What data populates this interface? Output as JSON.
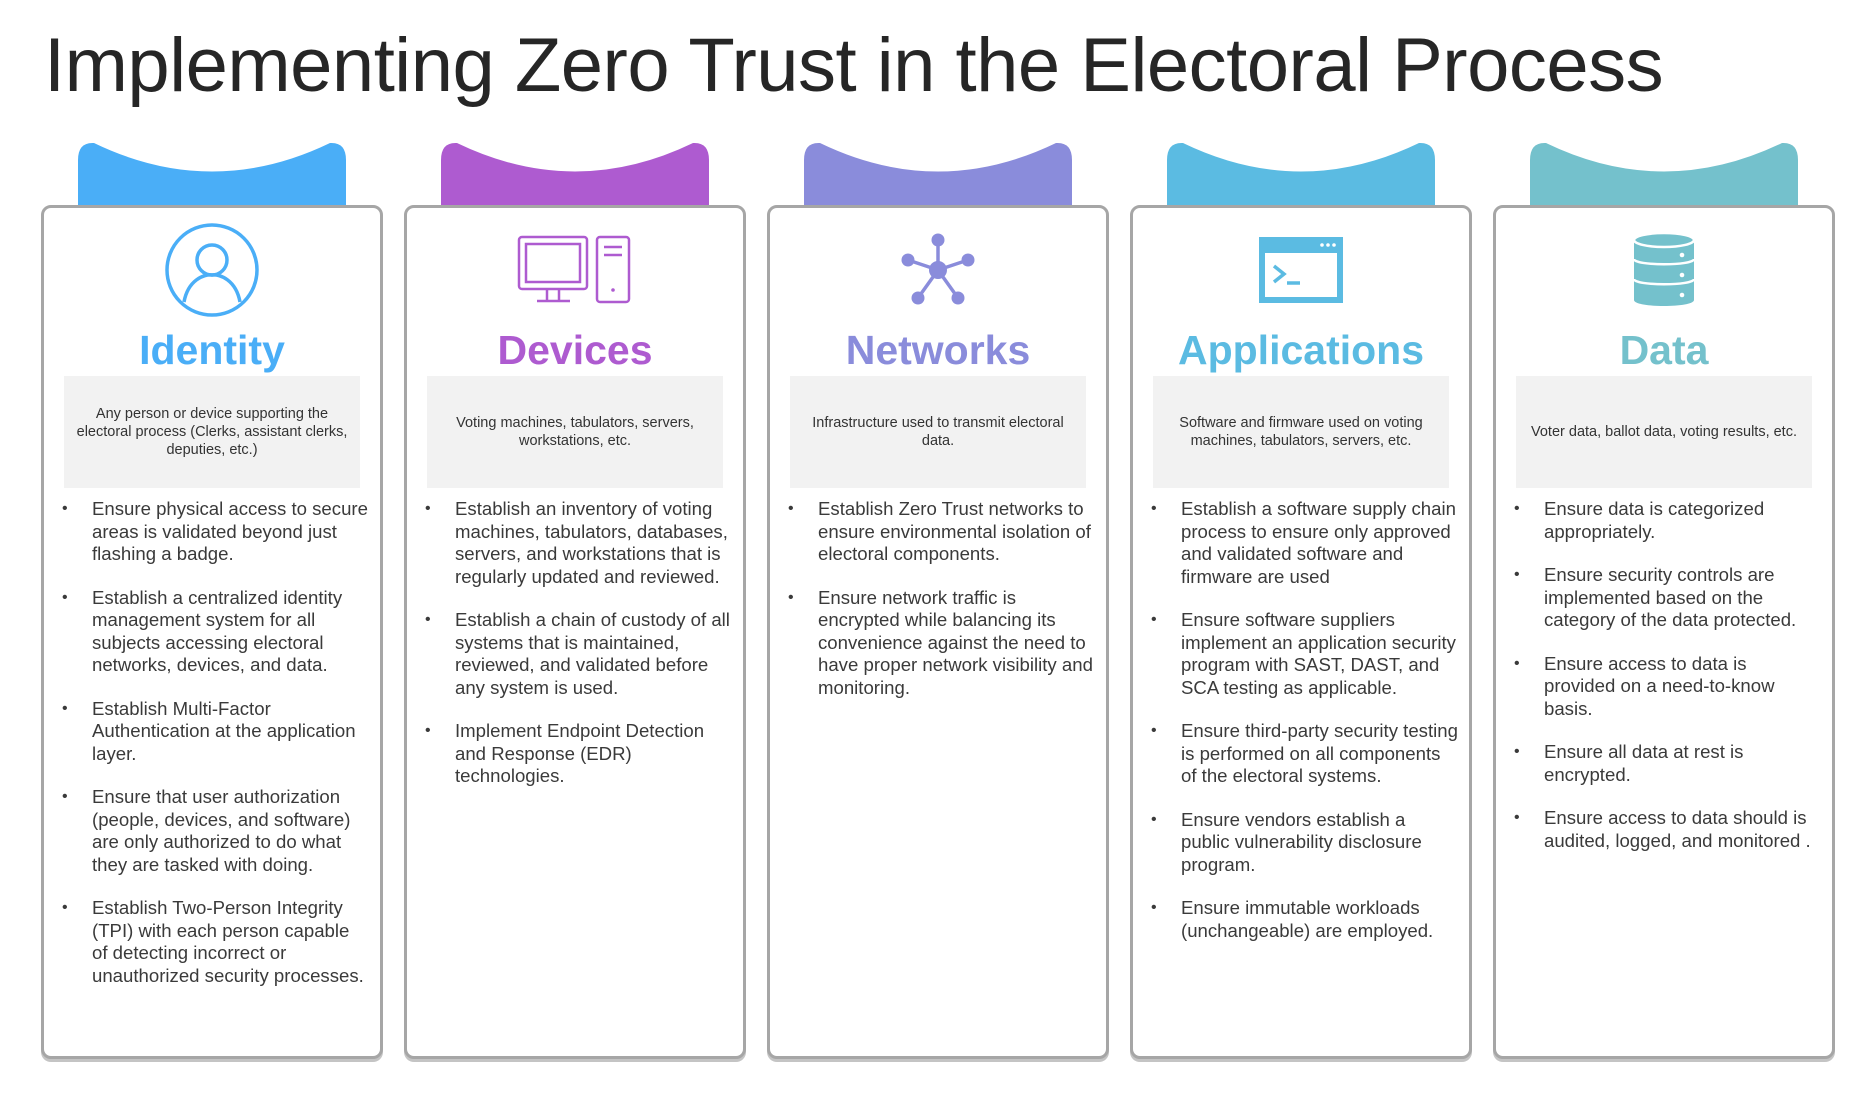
{
  "title": "Implementing Zero Trust in the Electoral Process",
  "columns": [
    {
      "id": "identity",
      "heading": "Identity",
      "color": "#4aaef7",
      "icon": "user-circle-icon",
      "description": "Any person or device supporting the electoral process (Clerks, assistant clerks, deputies, etc.)",
      "bullets": [
        "Ensure physical access to secure areas is validated beyond just flashing a badge.",
        "Establish a centralized identity management system for all subjects accessing electoral networks, devices, and data.",
        "Establish Multi-Factor Authentication at the application layer.",
        "Ensure that user authorization (people, devices, and software) are only authorized to do what they are tasked with doing.",
        "Establish Two-Person Integrity (TPI) with each person capable of detecting incorrect or unauthorized security processes."
      ]
    },
    {
      "id": "devices",
      "heading": "Devices",
      "color": "#ae5bd0",
      "icon": "desktop-computer-icon",
      "description": "Voting machines, tabulators, servers, workstations, etc.",
      "bullets": [
        "Establish an inventory of voting machines, tabulators, databases, servers, and workstations that is regularly updated and reviewed.",
        "Establish a chain of custody of all systems that is maintained, reviewed, and validated before any system is used.",
        "Implement Endpoint Detection and Response (EDR) technologies."
      ]
    },
    {
      "id": "networks",
      "heading": "Networks",
      "color": "#8a8cdb",
      "icon": "network-hub-icon",
      "description": "Infrastructure used to transmit electoral data.",
      "bullets": [
        "Establish Zero Trust networks to ensure environmental isolation of electoral components.",
        "Ensure network traffic is encrypted while balancing its convenience against the need to have proper network visibility and monitoring."
      ]
    },
    {
      "id": "applications",
      "heading": "Applications",
      "color": "#5bbbe2",
      "icon": "terminal-window-icon",
      "description": "Software and firmware used on voting machines, tabulators, servers, etc.",
      "bullets": [
        "Establish a software supply chain process to ensure only approved and validated software and firmware are used",
        "Ensure software suppliers implement an application security program with SAST, DAST, and SCA testing as applicable.",
        "Ensure third-party security testing is performed on all components of the electoral systems.",
        "Ensure vendors establish a public vulnerability disclosure program.",
        "Ensure immutable workloads (unchangeable) are employed."
      ]
    },
    {
      "id": "data",
      "heading": "Data",
      "color": "#74c1cc",
      "icon": "database-icon",
      "description": "Voter data, ballot data, voting results, etc.",
      "bullets": [
        "Ensure data  is categorized appropriately.",
        "Ensure security controls are implemented based on the category of the data protected.",
        "Ensure access to data is provided on a need-to-know basis.",
        "Ensure all data at rest is encrypted.",
        "Ensure access to data should is audited, logged, and monitored ."
      ]
    }
  ]
}
